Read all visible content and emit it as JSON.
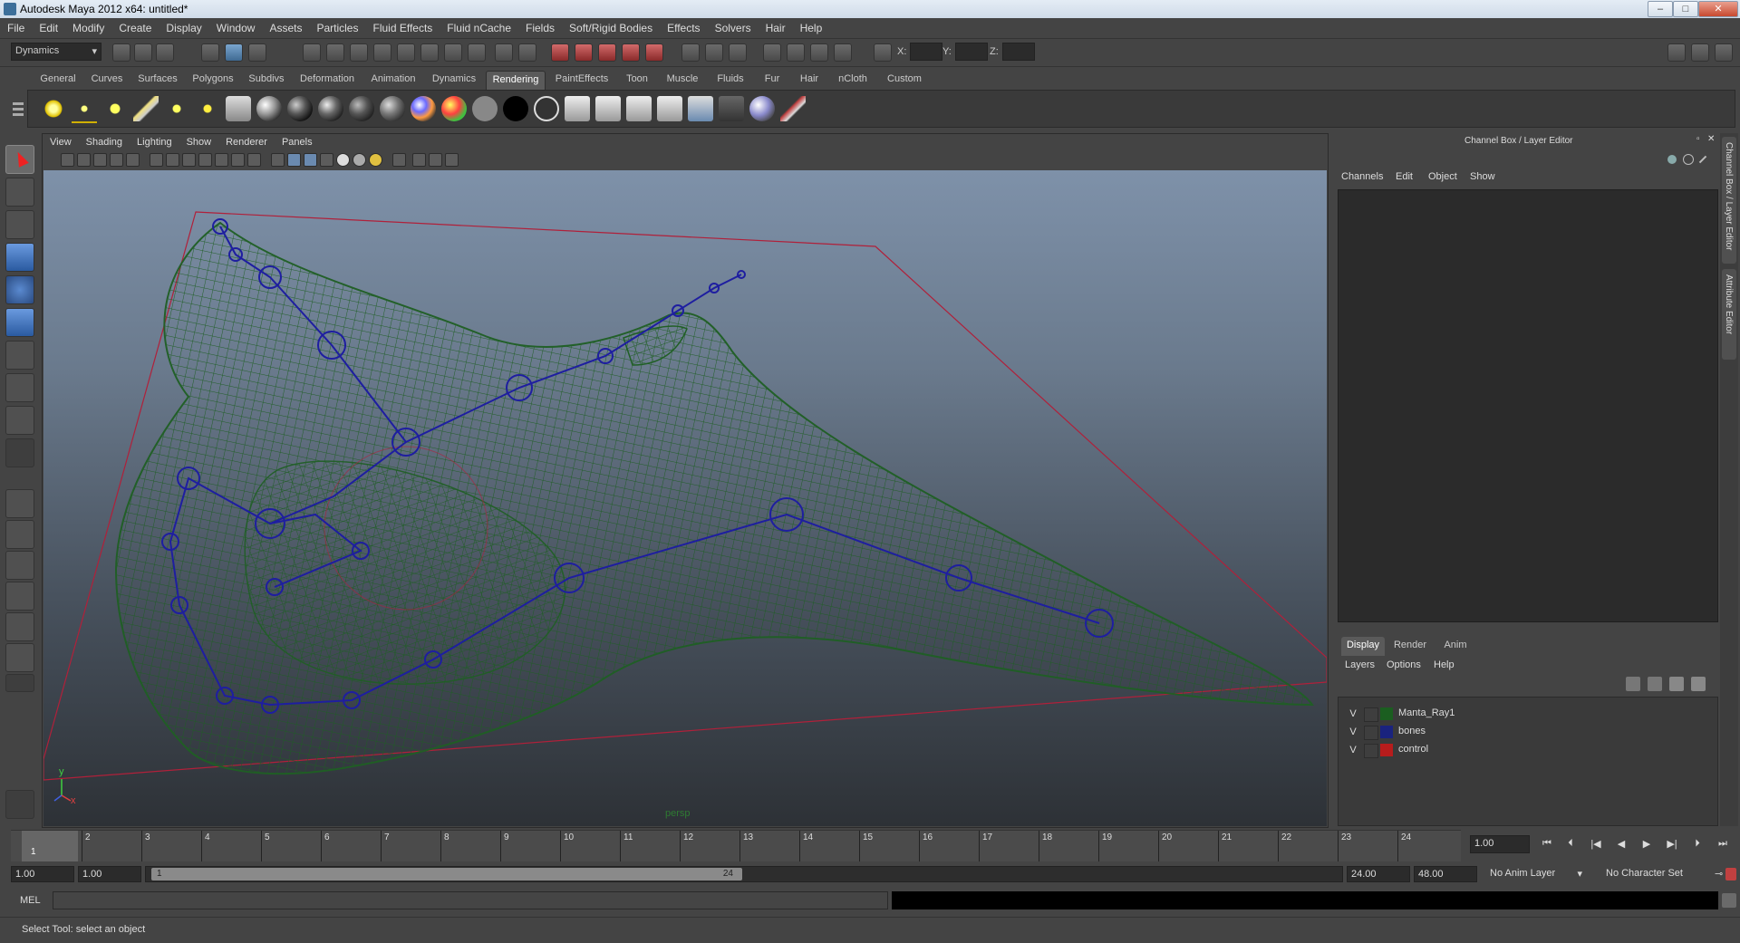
{
  "window": {
    "title": "Autodesk Maya 2012 x64: untitled*"
  },
  "menubar": [
    "File",
    "Edit",
    "Modify",
    "Create",
    "Display",
    "Window",
    "Assets",
    "Particles",
    "Fluid Effects",
    "Fluid nCache",
    "Fields",
    "Soft/Rigid Bodies",
    "Effects",
    "Solvers",
    "Hair",
    "Help"
  ],
  "statusline": {
    "menu_set": "Dynamics",
    "x_label": "X:",
    "y_label": "Y:",
    "z_label": "Z:"
  },
  "shelf": {
    "tabs": [
      "General",
      "Curves",
      "Surfaces",
      "Polygons",
      "Subdivs",
      "Deformation",
      "Animation",
      "Dynamics",
      "Rendering",
      "PaintEffects",
      "Toon",
      "Muscle",
      "Fluids",
      "Fur",
      "Hair",
      "nCloth",
      "Custom"
    ],
    "active_tab": "Rendering"
  },
  "viewport": {
    "menu": [
      "View",
      "Shading",
      "Lighting",
      "Show",
      "Renderer",
      "Panels"
    ],
    "camera_label": "persp",
    "axis_x": "x",
    "axis_y": "y"
  },
  "channel_box": {
    "header": "Channel Box / Layer Editor",
    "menu": [
      "Channels",
      "Edit",
      "Object",
      "Show"
    ]
  },
  "layer_editor": {
    "tabs": [
      "Display",
      "Render",
      "Anim"
    ],
    "active_tab": "Display",
    "menu": [
      "Layers",
      "Options",
      "Help"
    ],
    "layers": [
      {
        "visible": "V",
        "name": "Manta_Ray1",
        "color": "#1b5e20"
      },
      {
        "visible": "V",
        "name": "bones",
        "color": "#1a237e"
      },
      {
        "visible": "V",
        "name": "control",
        "color": "#b71c1c"
      }
    ]
  },
  "side_tabs": [
    "Channel Box / Layer Editor",
    "Attribute Editor"
  ],
  "timeslider": {
    "frames": [
      "1",
      "2",
      "3",
      "4",
      "5",
      "6",
      "7",
      "8",
      "9",
      "10",
      "11",
      "12",
      "13",
      "14",
      "15",
      "16",
      "17",
      "18",
      "19",
      "20",
      "21",
      "22",
      "23",
      "24"
    ],
    "current_marker": "1",
    "current_frame": "1.00"
  },
  "range": {
    "start_time": "1.00",
    "playback_start": "1.00",
    "range_start_label": "1",
    "range_end_label": "24",
    "playback_end": "24.00",
    "end_time": "48.00",
    "anim_layer": "No Anim Layer",
    "character_set": "No Character Set"
  },
  "command_line": {
    "label": "MEL"
  },
  "help_line": {
    "text": "Select Tool: select an object"
  },
  "colors": {
    "wire_green": "#1f5f24",
    "bones_blue": "#1e1ea0",
    "control_red": "#b0203a"
  }
}
